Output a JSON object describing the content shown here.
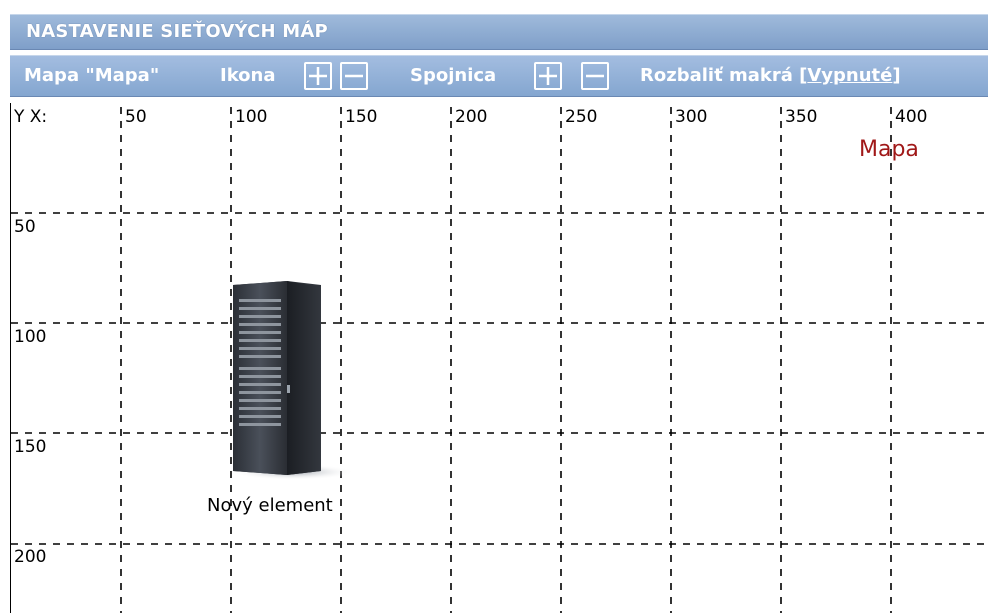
{
  "title": "NASTAVENIE SIEŤOVÝCH MÁP",
  "toolbar": {
    "map_label": "Mapa \"Mapa\"",
    "icon_label": "Ikona",
    "link_label": "Spojnica",
    "macro_label": "Rozbaliť makrá",
    "macro_open": "[",
    "macro_value": "Vypnuté",
    "macro_close": "]"
  },
  "grid": {
    "corner": "Y X:",
    "x_ticks": [
      "50",
      "100",
      "150",
      "200",
      "250",
      "300",
      "350",
      "400"
    ],
    "y_ticks": [
      "50",
      "100",
      "150",
      "200"
    ]
  },
  "map_name": "Mapa",
  "element": {
    "label": "Nový element",
    "icon": "server-icon"
  },
  "colors": {
    "header": "#8caad3",
    "map_name": "#a01818"
  }
}
